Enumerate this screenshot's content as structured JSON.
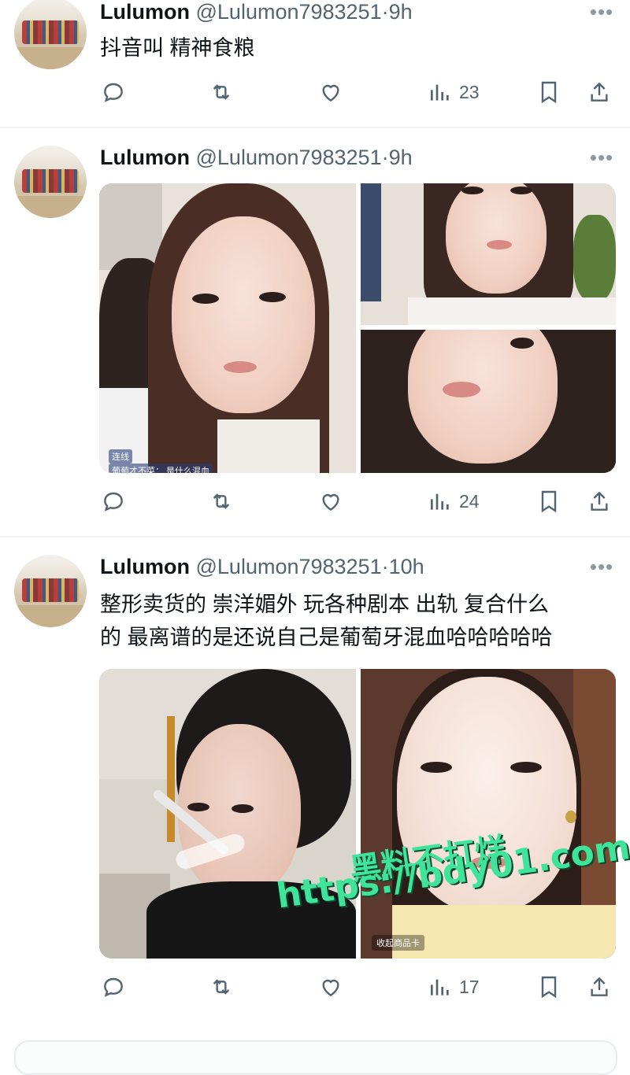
{
  "colors": {
    "text": "#0f1419",
    "secondary": "#536471",
    "divider": "#eff3f4",
    "watermark": "#3fe39a"
  },
  "tweets": [
    {
      "name": "Lulumon",
      "handle": "@Lulumon7983251",
      "separator": "·",
      "time": "9h",
      "lines": [
        "抖音叫 精神食粮"
      ],
      "views": "23"
    },
    {
      "name": "Lulumon",
      "handle": "@Lulumon7983251",
      "separator": "·",
      "time": "9h",
      "lines": [],
      "media_captions": [
        "连线",
        "葡萄才不菜： 是什么混血"
      ],
      "views": "24"
    },
    {
      "name": "Lulumon",
      "handle": "@Lulumon7983251",
      "separator": "·",
      "time": "10h",
      "lines": [
        "整形卖货的 崇洋媚外 玩各种剧本 出轨 复合什么",
        "的 最离谱的是还说自己是葡萄牙混血哈哈哈哈哈"
      ],
      "media_captions": [
        "收起商品卡"
      ],
      "views": "17"
    }
  ],
  "more_label": "•••",
  "watermark": {
    "line1": "黑料不打烊",
    "line2": "https://bdy01.com"
  },
  "icons": [
    "reply-icon",
    "retweet-icon",
    "like-icon",
    "views-icon",
    "bookmark-icon",
    "share-icon"
  ]
}
